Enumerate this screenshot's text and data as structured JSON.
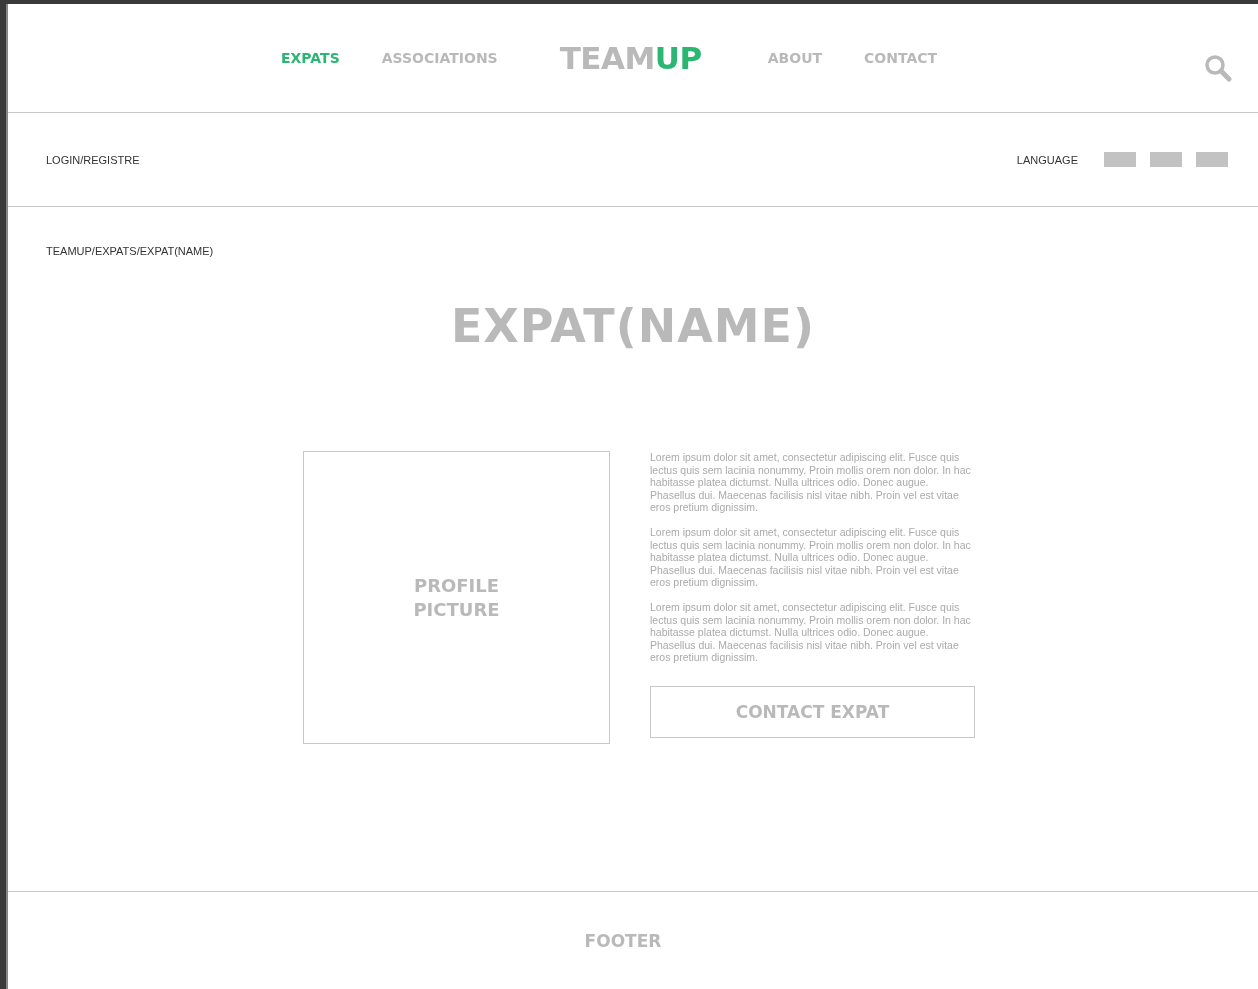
{
  "nav": {
    "left": [
      {
        "label": "EXPATS",
        "selected": true
      },
      {
        "label": "ASSOCIATIONS",
        "selected": false
      }
    ],
    "logo": {
      "part_1": "TEAM",
      "part_2": "UP"
    },
    "right": [
      {
        "label": "ABOUT",
        "selected": false
      },
      {
        "label": "CONTACT",
        "selected": false
      }
    ]
  },
  "account_bar": {
    "login": "LOGIN/REGISTRE",
    "language": "LANGUAGE"
  },
  "breadcrumb": "TEAMUP/EXPATS/EXPAT(NAME)",
  "title": "EXPAT(NAME)",
  "profile_picture": {
    "label_1": "PROFILE",
    "label_2": "PICTURE"
  },
  "paragraphs": [
    "Lorem ipsum dolor sit amet, consectetur adipiscing elit. Fusce quis lectus quis sem lacinia nonummy. Proin mollis orem non dolor. In hac habitasse platea dictumst. Nulla ultrices odio. Donec augue. Phasellus dui. Maecenas facilisis nisl vitae nibh. Proin vel est vitae eros pretium dignissim.",
    "Lorem ipsum dolor sit amet, consectetur adipiscing elit. Fusce quis lectus quis sem lacinia nonummy. Proin mollis orem non dolor. In hac habitasse platea dictumst. Nulla ultrices odio. Donec augue. Phasellus dui. Maecenas facilisis nisl vitae nibh. Proin vel est vitae eros pretium dignissim.",
    "Lorem ipsum dolor sit amet, consectetur adipiscing elit. Fusce quis lectus quis sem lacinia nonummy. Proin mollis orem non dolor. In hac habitasse platea dictumst. Nulla ultrices odio. Donec augue. Phasellus dui. Maecenas facilisis nisl vitae nibh. Proin vel est vitae eros pretium dignissim."
  ],
  "contact_button": "CONTACT EXPAT",
  "footer": "FOOTER"
}
